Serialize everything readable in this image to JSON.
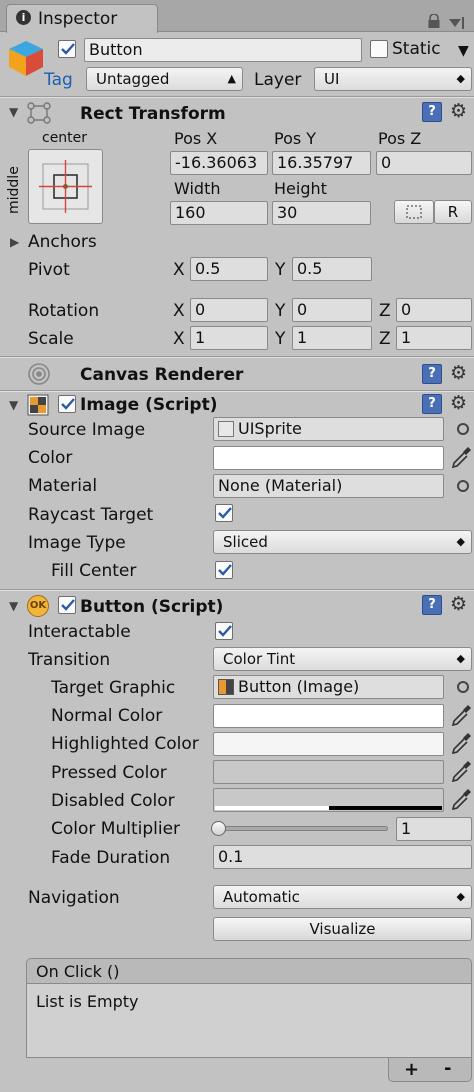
{
  "tab": {
    "title": "Inspector"
  },
  "object": {
    "name": "Button",
    "static_label": "Static",
    "tag_label": "Tag",
    "tag_value": "Untagged",
    "layer_label": "Layer",
    "layer_value": "UI"
  },
  "rect_transform": {
    "title": "Rect Transform",
    "anchor_h": "center",
    "anchor_v": "middle",
    "pos_x_label": "Pos X",
    "pos_y_label": "Pos Y",
    "pos_z_label": "Pos Z",
    "pos_x": "-16.36063",
    "pos_y": "16.35797",
    "pos_z": "0",
    "width_label": "Width",
    "height_label": "Height",
    "width": "160",
    "height": "30",
    "r_button": "R",
    "anchors_label": "Anchors",
    "pivot_label": "Pivot",
    "pivot_x": "0.5",
    "pivot_y": "0.5",
    "rotation_label": "Rotation",
    "rot_x": "0",
    "rot_y": "0",
    "rot_z": "0",
    "scale_label": "Scale",
    "scale_x": "1",
    "scale_y": "1",
    "scale_z": "1",
    "x": "X",
    "y": "Y",
    "z": "Z"
  },
  "canvas_renderer": {
    "title": "Canvas Renderer"
  },
  "image": {
    "title": "Image (Script)",
    "source_image_label": "Source Image",
    "source_image_value": "UISprite",
    "color_label": "Color",
    "material_label": "Material",
    "material_value": "None (Material)",
    "raycast_label": "Raycast Target",
    "image_type_label": "Image Type",
    "image_type_value": "Sliced",
    "fill_center_label": "Fill Center"
  },
  "button": {
    "title": "Button (Script)",
    "interactable_label": "Interactable",
    "transition_label": "Transition",
    "transition_value": "Color Tint",
    "target_graphic_label": "Target Graphic",
    "target_graphic_value": "Button (Image)",
    "normal_color_label": "Normal Color",
    "highlighted_color_label": "Highlighted Color",
    "pressed_color_label": "Pressed Color",
    "disabled_color_label": "Disabled Color",
    "color_multiplier_label": "Color Multiplier",
    "color_multiplier_value": "1",
    "color_multiplier_level": 0,
    "fade_duration_label": "Fade Duration",
    "fade_duration_value": "0.1",
    "navigation_label": "Navigation",
    "navigation_value": "Automatic",
    "visualize_label": "Visualize",
    "on_click_label": "On Click ()",
    "list_empty": "List is Empty",
    "plus": "+",
    "minus": "-"
  },
  "colors": {
    "normal": "#ffffff",
    "highlighted": "#f5f5f5",
    "pressed": "#c8c8c8",
    "disabled": "#c8c8c8",
    "help_icon": "#4a6fb5",
    "check": "#2a5aa8"
  },
  "icons": {
    "inspector": "info-icon",
    "lock": "lock-icon",
    "menu": "tab-menu-icon",
    "gameobject": "cube-icon",
    "rect_transform": "rect-transform-icon",
    "canvas_renderer": "eye-ring-icon",
    "image": "image-script-icon",
    "button": "ok-button-icon",
    "help": "help-book-icon",
    "gear": "gear-icon",
    "picker": "object-picker-icon",
    "eyedropper": "eyedropper-icon"
  }
}
